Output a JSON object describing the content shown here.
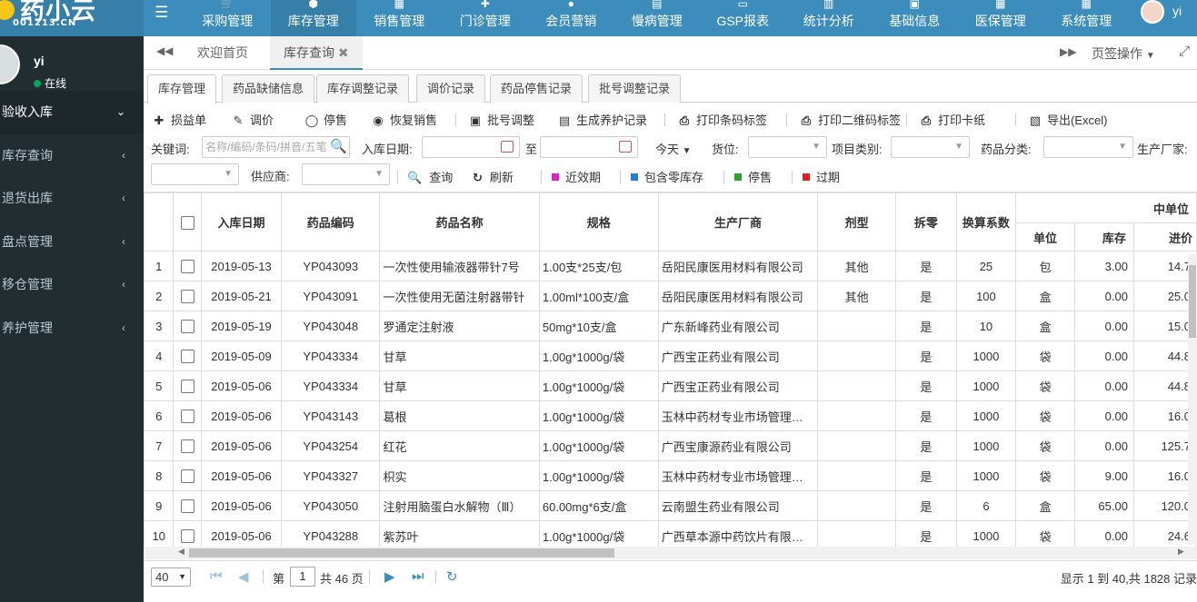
{
  "logo": {
    "text": "药小云",
    "sub": "001213.CN"
  },
  "nav": {
    "items": [
      {
        "label": "采购管理",
        "icon": "cart-icon",
        "glyph": "🛒"
      },
      {
        "label": "库存管理",
        "icon": "cube-icon",
        "glyph": "⬢",
        "active": true
      },
      {
        "label": "销售管理",
        "icon": "shop-icon",
        "glyph": "▦"
      },
      {
        "label": "门诊管理",
        "icon": "medkit-icon",
        "glyph": "✚"
      },
      {
        "label": "会员营销",
        "icon": "users-icon",
        "glyph": "●"
      },
      {
        "label": "慢病管理",
        "icon": "calendar-icon",
        "glyph": "▤"
      },
      {
        "label": "GSP报表",
        "icon": "report-icon",
        "glyph": "▭"
      },
      {
        "label": "统计分析",
        "icon": "chart-icon",
        "glyph": "▥"
      },
      {
        "label": "基础信息",
        "icon": "folder-icon",
        "glyph": "▣"
      },
      {
        "label": "医保管理",
        "icon": "windows-icon",
        "glyph": "▦"
      },
      {
        "label": "系统管理",
        "icon": "settings-icon",
        "glyph": "▦"
      }
    ],
    "user": "yi"
  },
  "sidebar": {
    "user": {
      "name": "yi",
      "status": "在线"
    },
    "items": [
      {
        "label": "验收入库",
        "open": true,
        "chevron": "⌄"
      },
      {
        "label": "库存查询",
        "chevron": "‹"
      },
      {
        "label": "退货出库",
        "chevron": "‹"
      },
      {
        "label": "盘点管理",
        "chevron": "‹"
      },
      {
        "label": "移仓管理",
        "chevron": "‹"
      },
      {
        "label": "养护管理",
        "chevron": "‹"
      }
    ]
  },
  "tabs": {
    "home": "欢迎首页",
    "current": "库存查询",
    "page_ops": "页签操作"
  },
  "subtabs": [
    "库存管理",
    "药品缺储信息",
    "库存调整记录",
    "调价记录",
    "药品停售记录",
    "批号调整记录"
  ],
  "toolbar": [
    {
      "label": "损益单",
      "glyph": "✚"
    },
    {
      "label": "调价",
      "glyph": "✎"
    },
    {
      "label": "停售",
      "glyph": "◯"
    },
    {
      "label": "恢复销售",
      "glyph": "◉"
    },
    {
      "label": "批号调整",
      "glyph": "▣"
    },
    {
      "label": "生成养护记录",
      "glyph": "▤"
    },
    {
      "label": "打印条码标签",
      "glyph": "⎙"
    },
    {
      "label": "打印二维码标签",
      "glyph": "⎙"
    },
    {
      "label": "打印卡纸",
      "glyph": "⎙"
    },
    {
      "label": "导出(Excel)",
      "glyph": "▧"
    }
  ],
  "filters": {
    "keyword_label": "关键词:",
    "keyword_placeholder": "名称/编码/条码/拼音/五笔",
    "date_label": "入库日期:",
    "to_label": "至",
    "today": "今天",
    "location_label": "货位:",
    "project_label": "项目类别:",
    "category_label": "药品分类:",
    "maker_label": "生产厂家:",
    "supplier_label": "供应商:",
    "query": "查询",
    "refresh": "刷新",
    "legend": [
      {
        "label": "近效期",
        "color": "#e020d0"
      },
      {
        "label": "包含零库存",
        "color": "#1e7fd8"
      },
      {
        "label": "停售",
        "color": "#2aa52a"
      },
      {
        "label": "过期",
        "color": "#e02020"
      }
    ]
  },
  "grid": {
    "group_header": "中单位",
    "columns": [
      "入库日期",
      "药品编码",
      "药品名称",
      "规格",
      "生产厂商",
      "剂型",
      "拆零",
      "换算系数"
    ],
    "sub_columns": [
      "单位",
      "库存",
      "进价"
    ],
    "rows": [
      {
        "n": "1",
        "date": "2019-05-13",
        "code": "YP043093",
        "name": "一次性使用输液器带针7号",
        "spec": "1.00支*25支/包",
        "maker": "岳阳民康医用材料有限公司",
        "form": "其他",
        "split": "是",
        "factor": "25",
        "unit": "包",
        "stock": "3.00",
        "price": "14.7"
      },
      {
        "n": "2",
        "date": "2019-05-21",
        "code": "YP043091",
        "name": "一次性使用无菌注射器带针",
        "spec": "1.00ml*100支/盒",
        "maker": "岳阳民康医用材料有限公司",
        "form": "其他",
        "split": "是",
        "factor": "100",
        "unit": "盒",
        "stock": "0.00",
        "price": "25.0"
      },
      {
        "n": "3",
        "date": "2019-05-19",
        "code": "YP043048",
        "name": "罗通定注射液",
        "spec": "50mg*10支/盒",
        "maker": "广东新峰药业有限公司",
        "form": "",
        "split": "是",
        "factor": "10",
        "unit": "盒",
        "stock": "0.00",
        "price": "15.0"
      },
      {
        "n": "4",
        "date": "2019-05-09",
        "code": "YP043334",
        "name": "甘草",
        "spec": "1.00g*1000g/袋",
        "maker": "广西宝正药业有限公司",
        "form": "",
        "split": "是",
        "factor": "1000",
        "unit": "袋",
        "stock": "0.00",
        "price": "44.8"
      },
      {
        "n": "5",
        "date": "2019-05-06",
        "code": "YP043334",
        "name": "甘草",
        "spec": "1.00g*1000g/袋",
        "maker": "广西宝正药业有限公司",
        "form": "",
        "split": "是",
        "factor": "1000",
        "unit": "袋",
        "stock": "0.00",
        "price": "44.8"
      },
      {
        "n": "6",
        "date": "2019-05-06",
        "code": "YP043143",
        "name": "葛根",
        "spec": "1.00g*1000g/袋",
        "maker": "玉林中药材专业市场管理…",
        "form": "",
        "split": "是",
        "factor": "1000",
        "unit": "袋",
        "stock": "0.00",
        "price": "16.0"
      },
      {
        "n": "7",
        "date": "2019-05-06",
        "code": "YP043254",
        "name": "红花",
        "spec": "1.00g*1000g/袋",
        "maker": "广西宝康源药业有限公司",
        "form": "",
        "split": "是",
        "factor": "1000",
        "unit": "袋",
        "stock": "0.00",
        "price": "125.7"
      },
      {
        "n": "8",
        "date": "2019-05-06",
        "code": "YP043327",
        "name": "枳实",
        "spec": "1.00g*1000g/袋",
        "maker": "玉林中药材专业市场管理…",
        "form": "",
        "split": "是",
        "factor": "1000",
        "unit": "袋",
        "stock": "9.00",
        "price": "16.0"
      },
      {
        "n": "9",
        "date": "2019-05-06",
        "code": "YP043050",
        "name": "注射用脑蛋白水解物（Ⅲ）",
        "spec": "60.00mg*6支/盒",
        "maker": "云南盟生药业有限公司",
        "form": "",
        "split": "是",
        "factor": "6",
        "unit": "盒",
        "stock": "65.00",
        "price": "120.0"
      },
      {
        "n": "10",
        "date": "2019-05-06",
        "code": "YP043288",
        "name": "紫苏叶",
        "spec": "1.00g*1000g/袋",
        "maker": "广西草本源中药饮片有限…",
        "form": "",
        "split": "是",
        "factor": "1000",
        "unit": "袋",
        "stock": "0.00",
        "price": "24.6"
      }
    ]
  },
  "pager": {
    "page_size": "40",
    "page_label": "第",
    "page": "1",
    "total_pages": "共 46 页",
    "info": "显示 1 到 40,共 1828 记录"
  }
}
